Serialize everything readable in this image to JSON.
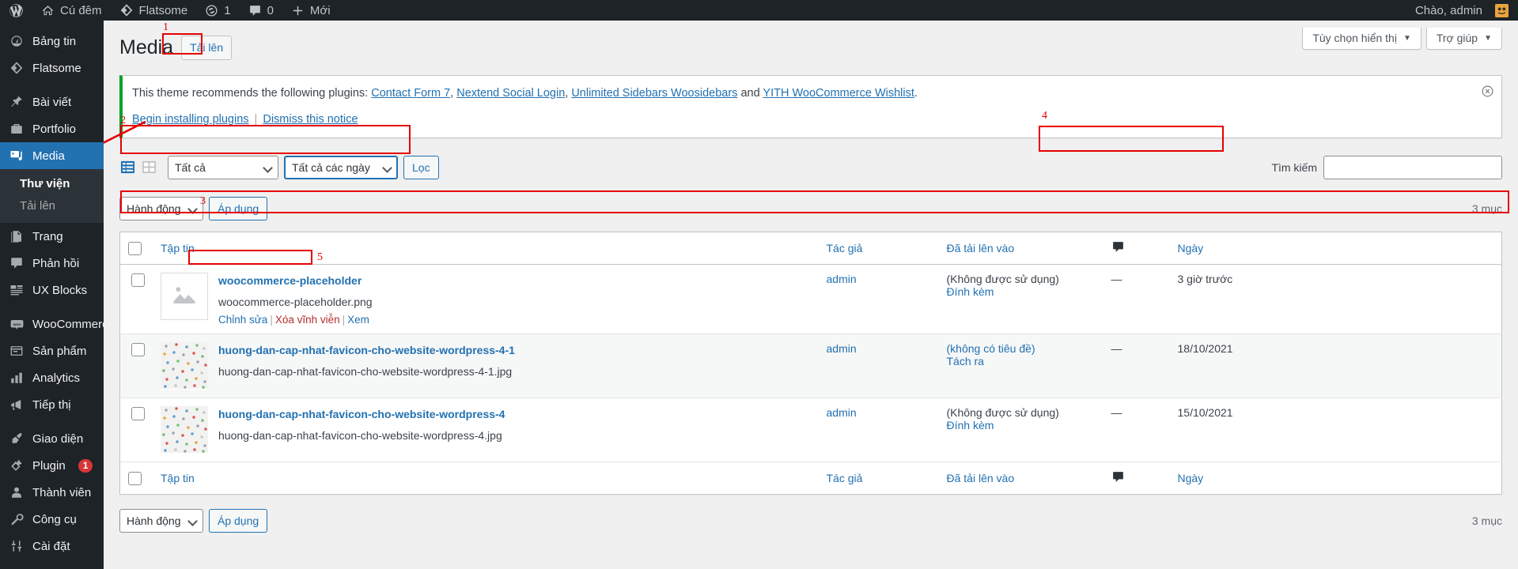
{
  "adminbar": {
    "logo_icon": "wordpress-icon",
    "items": [
      {
        "label": "Cú đêm",
        "icon": "home-icon"
      },
      {
        "label": "Flatsome",
        "icon": "flatsome-icon"
      },
      {
        "label": "1",
        "icon": "update-icon"
      },
      {
        "label": "0",
        "icon": "comment-icon"
      },
      {
        "label": "Mới",
        "icon": "plus-icon"
      }
    ],
    "greeting": "Chào, admin",
    "avatar_icon": "user-avatar"
  },
  "sidebar": {
    "items": [
      {
        "label": "Bảng tin",
        "icon": "dashboard-icon",
        "current": false
      },
      {
        "label": "Flatsome",
        "icon": "flatsome-icon",
        "current": false
      },
      {
        "separator_after": true
      },
      {
        "label": "Bài viết",
        "icon": "pin-icon",
        "current": false
      },
      {
        "label": "Portfolio",
        "icon": "portfolio-icon",
        "current": false
      },
      {
        "label": "Media",
        "icon": "media-icon",
        "current": true
      },
      {
        "label": "Trang",
        "icon": "page-icon",
        "current": false
      },
      {
        "label": "Phản hồi",
        "icon": "comment-icon",
        "current": false
      },
      {
        "label": "UX Blocks",
        "icon": "blocks-icon",
        "current": false
      },
      {
        "separator_after": true
      },
      {
        "label": "WooCommerce",
        "icon": "woocommerce-icon",
        "current": false
      },
      {
        "label": "Sản phẩm",
        "icon": "products-icon",
        "current": false
      },
      {
        "label": "Analytics",
        "icon": "analytics-icon",
        "current": false
      },
      {
        "label": "Tiếp thị",
        "icon": "megaphone-icon",
        "current": false
      },
      {
        "separator_after": true
      },
      {
        "label": "Giao diện",
        "icon": "appearance-icon",
        "current": false
      },
      {
        "label": "Plugin",
        "icon": "plugin-icon",
        "current": false,
        "badge": "1"
      },
      {
        "label": "Thành viên",
        "icon": "users-icon",
        "current": false
      },
      {
        "label": "Công cụ",
        "icon": "tools-icon",
        "current": false
      },
      {
        "label": "Cài đặt",
        "icon": "settings-icon",
        "current": false
      }
    ],
    "submenu": [
      {
        "label": "Thư viện",
        "current": true
      },
      {
        "label": "Tải lên",
        "current": false
      }
    ]
  },
  "screen_meta": {
    "screen_options_label": "Tùy chọn hiển thị",
    "help_label": "Trợ giúp"
  },
  "page": {
    "title": "Media",
    "add_new_label": "Tải lên"
  },
  "notice": {
    "text_before": "This theme recommends the following plugins: ",
    "plugins": [
      {
        "name": "Contact Form 7",
        "sep": ", "
      },
      {
        "name": "Nextend Social Login",
        "sep": ", "
      },
      {
        "name": "Unlimited Sidebars Woosidebars",
        "sep": " and "
      },
      {
        "name": "YITH WooCommerce Wishlist",
        "sep": "."
      }
    ],
    "begin_label": "Begin installing plugins",
    "dismiss_label": "Dismiss this notice",
    "divider": "|",
    "close_icon": "close-circle-icon"
  },
  "filters": {
    "list_view_icon": "list-view-icon",
    "grid_view_icon": "grid-view-icon",
    "type_filter_value": "Tất cả",
    "date_filter_value": "Tất cả các ngày",
    "filter_button_label": "Lọc",
    "search_label": "Tìm kiếm",
    "search_value": "",
    "search_placeholder": ""
  },
  "bulk": {
    "action_value": "Hành động",
    "apply_label": "Áp dụng",
    "count_label": "3 mục"
  },
  "table": {
    "columns": [
      {
        "key": "cb",
        "label": ""
      },
      {
        "key": "title",
        "label": "Tập tin"
      },
      {
        "key": "author",
        "label": "Tác giả"
      },
      {
        "key": "parent",
        "label": "Đã tải lên vào"
      },
      {
        "key": "comments",
        "label": "comment-icon"
      },
      {
        "key": "date",
        "label": "Ngày"
      }
    ],
    "rows": [
      {
        "title": "woocommerce-placeholder",
        "filename": "woocommerce-placeholder.png",
        "thumb": "placeholder-image-icon",
        "actions": [
          {
            "label": "Chỉnh sửa",
            "kind": "edit"
          },
          {
            "label": "Xóa vĩnh viễn",
            "kind": "trash"
          },
          {
            "label": "Xem",
            "kind": "view"
          }
        ],
        "author": "admin",
        "parent": "(Không được sử dụng)",
        "parent_action": "Đính kèm",
        "comments": "—",
        "date": "3 giờ trước"
      },
      {
        "title": "huong-dan-cap-nhat-favicon-cho-website-wordpress-4-1",
        "filename": "huong-dan-cap-nhat-favicon-cho-website-wordpress-4-1.jpg",
        "thumb": "dots-pattern-image",
        "actions": [],
        "author": "admin",
        "parent": "(không có tiêu đề)",
        "parent_action": "Tách ra",
        "comments": "—",
        "date": "18/10/2021"
      },
      {
        "title": "huong-dan-cap-nhat-favicon-cho-website-wordpress-4",
        "filename": "huong-dan-cap-nhat-favicon-cho-website-wordpress-4.jpg",
        "thumb": "dots-pattern-image",
        "actions": [],
        "author": "admin",
        "parent": "(Không được sử dụng)",
        "parent_action": "Đính kèm",
        "comments": "—",
        "date": "15/10/2021"
      }
    ]
  },
  "annotations": [
    {
      "num": "1",
      "target": "upload-button"
    },
    {
      "num": "2",
      "target": "filter-toolbar"
    },
    {
      "num": "3",
      "target": "table-header-row"
    },
    {
      "num": "4",
      "target": "search-input"
    },
    {
      "num": "5",
      "target": "row-actions"
    }
  ],
  "colors": {
    "accent": "#2271b1",
    "admin_dark": "#1d2327",
    "annotation": "#e60000",
    "notice_green": "#00a32a",
    "badge_red": "#d63638"
  }
}
